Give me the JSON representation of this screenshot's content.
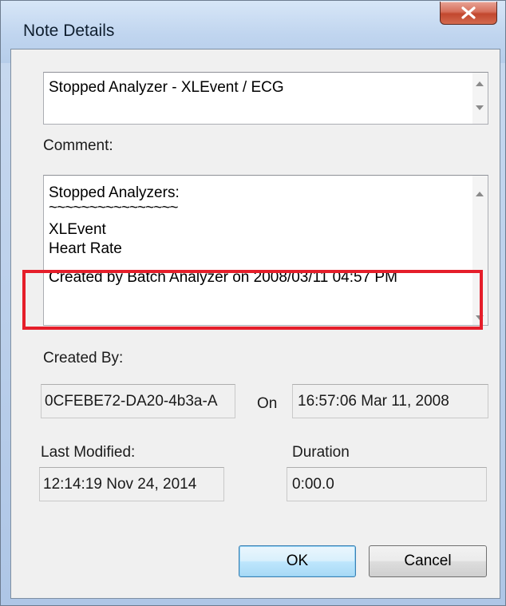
{
  "window": {
    "title": "Note Details",
    "close_icon": "close-x-icon"
  },
  "note": {
    "title_value": "Stopped Analyzer - XLEvent / ECG"
  },
  "comment": {
    "label": "Comment:",
    "lines": [
      "Stopped Analyzers:",
      "~~~~~~~~~~~~~~~~",
      "XLEvent",
      "Heart Rate",
      "Created by Batch Analyzer on 2008/03/11 04:57 PM"
    ]
  },
  "created": {
    "label": "Created By:",
    "by_value": "0CFEBE72-DA20-4b3a-A",
    "on_label": "On",
    "on_value": "16:57:06 Mar 11, 2008"
  },
  "modified": {
    "label": "Last Modified:",
    "value": "12:14:19 Nov 24, 2014"
  },
  "duration": {
    "label": "Duration",
    "value": "0:00.0"
  },
  "buttons": {
    "ok": "OK",
    "cancel": "Cancel"
  },
  "colors": {
    "highlight": "#e51e2a",
    "default_button_border": "#3c7fb1"
  }
}
